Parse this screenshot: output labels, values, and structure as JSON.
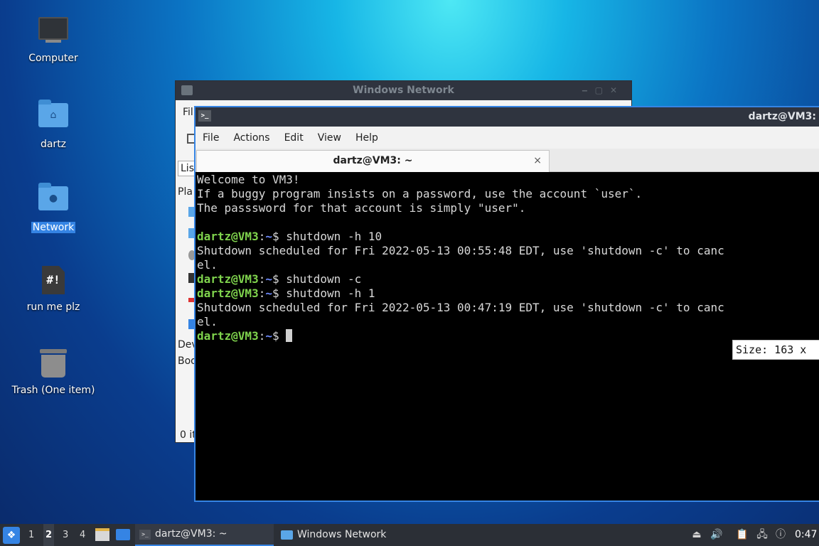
{
  "desktop": {
    "icons": [
      {
        "label": "Computer"
      },
      {
        "label": "dartz"
      },
      {
        "label": "Network"
      },
      {
        "label": "run me plz",
        "glyph": "#!"
      },
      {
        "label": "Trash (One item)"
      }
    ]
  },
  "file_manager": {
    "title": "Windows Network",
    "menu_partial": "Fil",
    "view_partial": "Lis",
    "places_partial": "Pla",
    "devices_partial": "Dev",
    "bookmarks_partial": "Boo",
    "status_partial": "0 it"
  },
  "terminal": {
    "title": "dartz@VM3:",
    "menu": [
      "File",
      "Actions",
      "Edit",
      "View",
      "Help"
    ],
    "tab_label": "dartz@VM3: ~",
    "tab_close": "×",
    "prompt_user": "dartz@VM3",
    "prompt_sep": ":",
    "prompt_path": "~",
    "prompt_sym": "$ ",
    "lines": [
      {
        "type": "out",
        "text": "Welcome to VM3!"
      },
      {
        "type": "out",
        "text": "If a buggy program insists on a password, use the account `user`."
      },
      {
        "type": "out",
        "text": "The passsword for that account is simply \"user\"."
      },
      {
        "type": "out",
        "text": ""
      },
      {
        "type": "cmd",
        "text": "shutdown -h 10"
      },
      {
        "type": "out",
        "text": "Shutdown scheduled for Fri 2022-05-13 00:55:48 EDT, use 'shutdown -c' to canc"
      },
      {
        "type": "out",
        "text": "el."
      },
      {
        "type": "cmd",
        "text": "shutdown -c"
      },
      {
        "type": "cmd",
        "text": "shutdown -h 1"
      },
      {
        "type": "out",
        "text": "Shutdown scheduled for Fri 2022-05-13 00:47:19 EDT, use 'shutdown -c' to canc"
      },
      {
        "type": "out",
        "text": "el."
      },
      {
        "type": "prompt",
        "text": ""
      }
    ],
    "size_tooltip": "Size: 163 x"
  },
  "taskbar": {
    "workspaces": [
      "1",
      "2",
      "3",
      "4"
    ],
    "active_workspace": "2",
    "tasks": [
      {
        "label": "dartz@VM3: ~",
        "icon": "terminal-icon"
      },
      {
        "label": "Windows Network",
        "icon": "folder-icon"
      }
    ],
    "clock": "0:47"
  },
  "colors": {
    "accent": "#3584e4",
    "prompt_user": "#7fd34d",
    "prompt_path": "#6f8cff",
    "titlebar": "#2f343f"
  }
}
